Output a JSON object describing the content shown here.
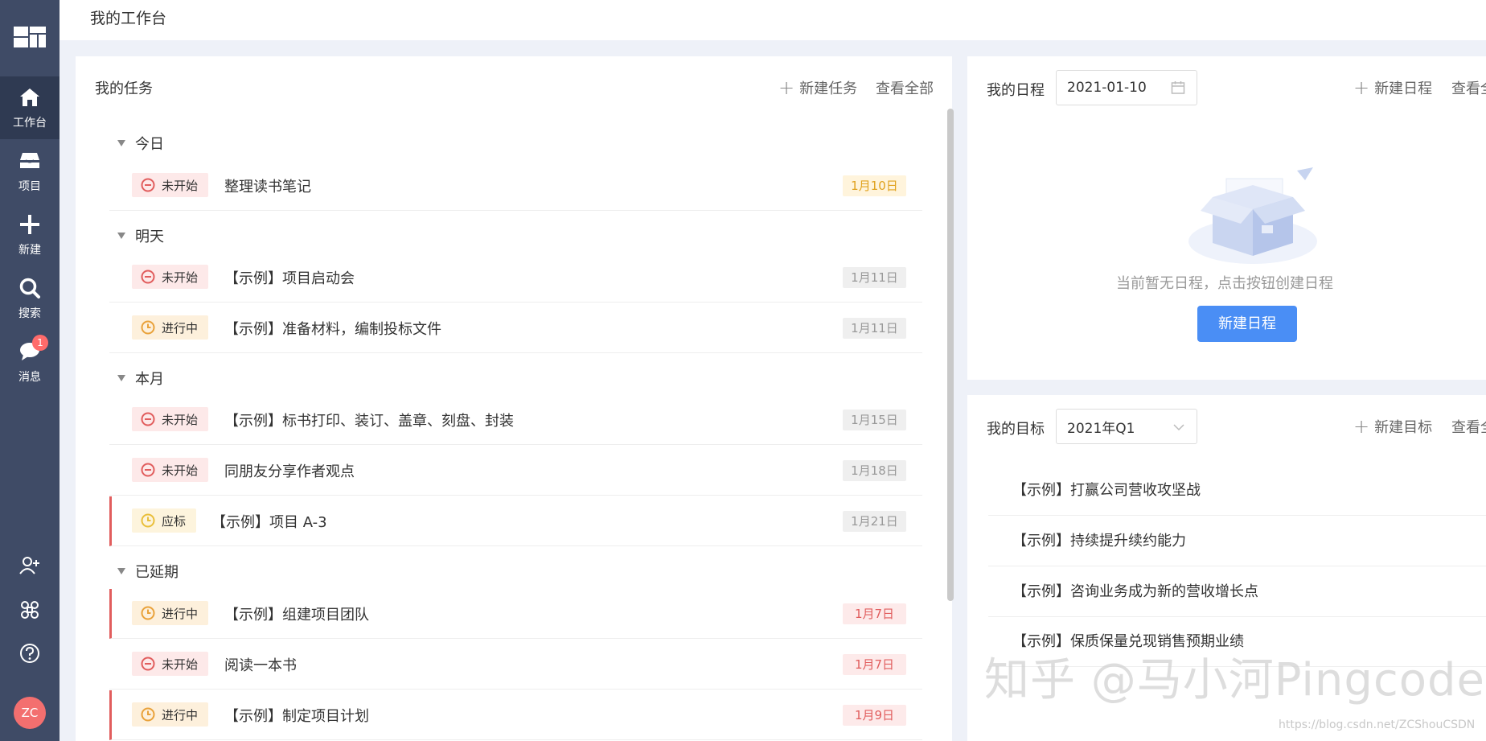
{
  "header": {
    "title": "我的工作台"
  },
  "sidebar": {
    "items": [
      {
        "label": "工作台",
        "icon": "home-icon"
      },
      {
        "label": "项目",
        "icon": "inbox-icon"
      },
      {
        "label": "新建",
        "icon": "plus-icon"
      },
      {
        "label": "搜索",
        "icon": "search-icon"
      },
      {
        "label": "消息",
        "icon": "chat-icon",
        "badge": "1"
      }
    ],
    "tools": [
      "add-member-icon",
      "command-icon",
      "help-icon"
    ],
    "avatar": "ZC"
  },
  "tasks": {
    "title": "我的任务",
    "new_label": "新建任务",
    "view_all": "查看全部",
    "groups": [
      {
        "title": "今日",
        "rows": [
          {
            "status": "未开始",
            "name": "整理读书笔记",
            "due": "1月10日"
          }
        ]
      },
      {
        "title": "明天",
        "rows": [
          {
            "status": "未开始",
            "name": "【示例】项目启动会",
            "due": "1月11日"
          },
          {
            "status": "进行中",
            "name": "【示例】准备材料，编制投标文件",
            "due": "1月11日"
          }
        ]
      },
      {
        "title": "本月",
        "rows": [
          {
            "status": "未开始",
            "name": "【示例】标书打印、装订、盖章、刻盘、封装",
            "due": "1月15日"
          },
          {
            "status": "未开始",
            "name": "同朋友分享作者观点",
            "due": "1月18日"
          },
          {
            "status": "应标",
            "name": "【示例】项目 A-3",
            "due": "1月21日"
          }
        ]
      },
      {
        "title": "已延期",
        "rows": [
          {
            "status": "进行中",
            "name": "【示例】组建项目团队",
            "due": "1月7日"
          },
          {
            "status": "未开始",
            "name": "阅读一本书",
            "due": "1月7日"
          },
          {
            "status": "进行中",
            "name": "【示例】制定项目计划",
            "due": "1月9日"
          }
        ]
      }
    ]
  },
  "schedule": {
    "title": "我的日程",
    "date": "2021-01-10",
    "new_label": "新建日程",
    "view_all": "查看全",
    "empty_text": "当前暂无日程，点击按钮创建日程",
    "button": "新建日程"
  },
  "goals": {
    "title": "我的目标",
    "period": "2021年Q1",
    "new_label": "新建目标",
    "view_all": "查看全",
    "items": [
      "【示例】打赢公司营收攻坚战",
      "【示例】持续提升续约能力",
      "【示例】咨询业务成为新的营收增长点",
      "【示例】保质保量兑现销售预期业绩"
    ]
  },
  "watermark": {
    "main": "知乎 @马小河Pingcode",
    "small": "https://blog.csdn.net/ZCShouCSDN"
  },
  "colors": {
    "sidebar": "#3f4b66",
    "primary": "#4a8ef5",
    "danger": "#e15d5d",
    "warning": "#e0a21f"
  }
}
